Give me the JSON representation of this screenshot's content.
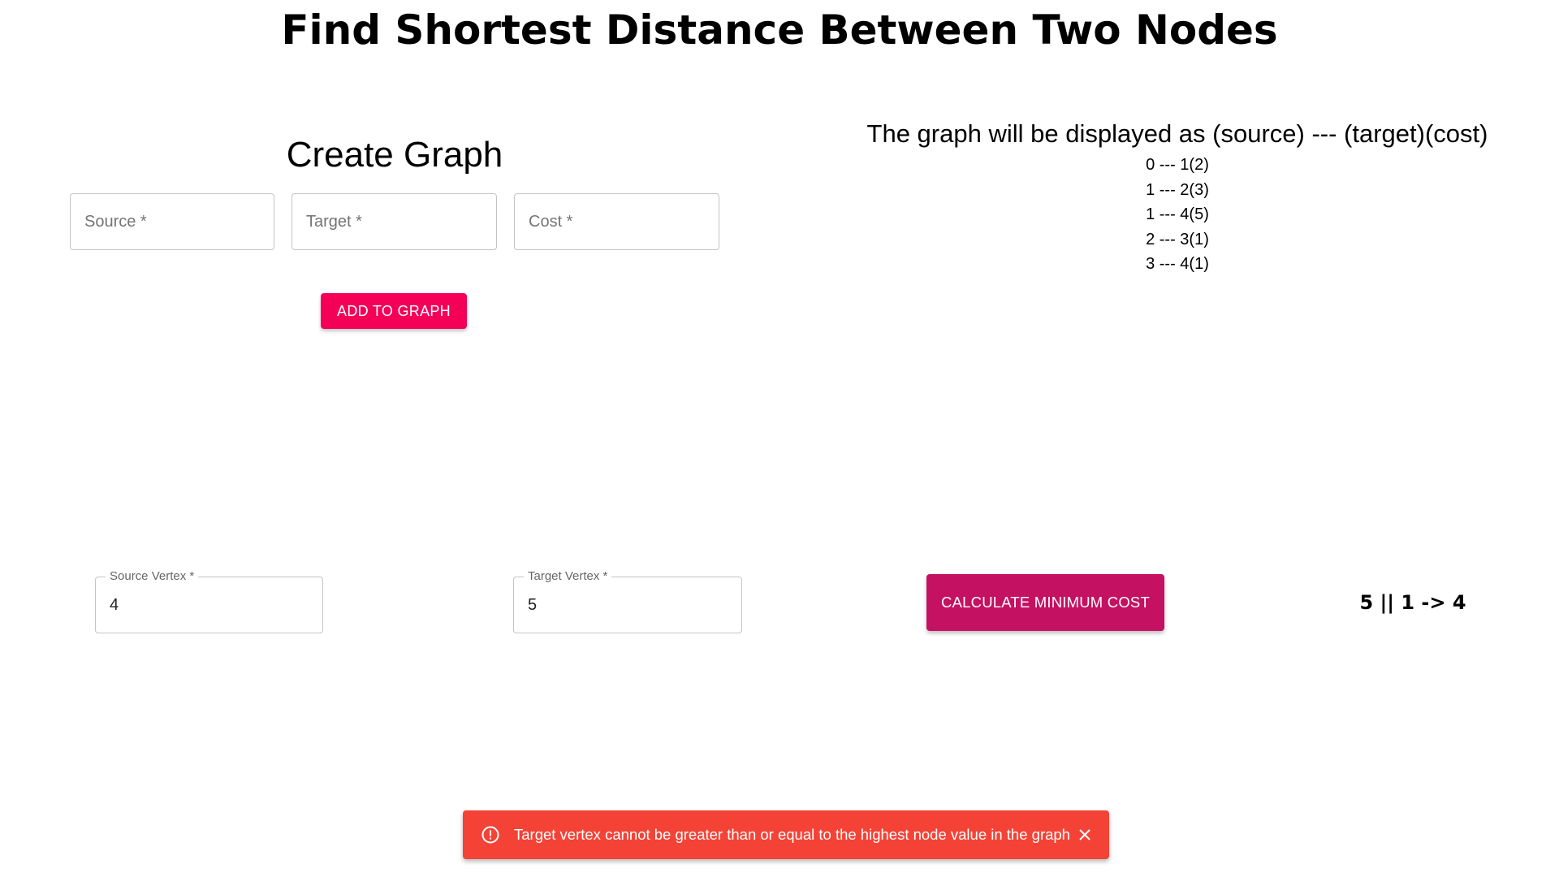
{
  "header": {
    "title": "Find Shortest Distance Between Two Nodes"
  },
  "create_graph": {
    "title": "Create Graph",
    "source_placeholder": "Source *",
    "target_placeholder": "Target *",
    "cost_placeholder": "Cost *",
    "add_button_label": "ADD TO GRAPH"
  },
  "graph_display": {
    "header": "The graph will be displayed as (source) --- (target)(cost)",
    "edges": [
      "0 --- 1(2)",
      "1 --- 2(3)",
      "1 --- 4(5)",
      "2 --- 3(1)",
      "3 --- 4(1)"
    ]
  },
  "query": {
    "source_label": "Source Vertex *",
    "source_value": "4",
    "target_label": "Target Vertex *",
    "target_value": "5",
    "calculate_button_label": "CALCULATE MINIMUM COST",
    "result": "5 || 1 -> 4"
  },
  "snackbar": {
    "message": "Target vertex cannot be greater than or equal to the highest node value in the graph",
    "icon": "error-outline-icon",
    "close_icon": "close-icon"
  },
  "colors": {
    "add_button": "#f50057",
    "calculate_button": "#c51162",
    "snackbar_error": "#f44336"
  }
}
